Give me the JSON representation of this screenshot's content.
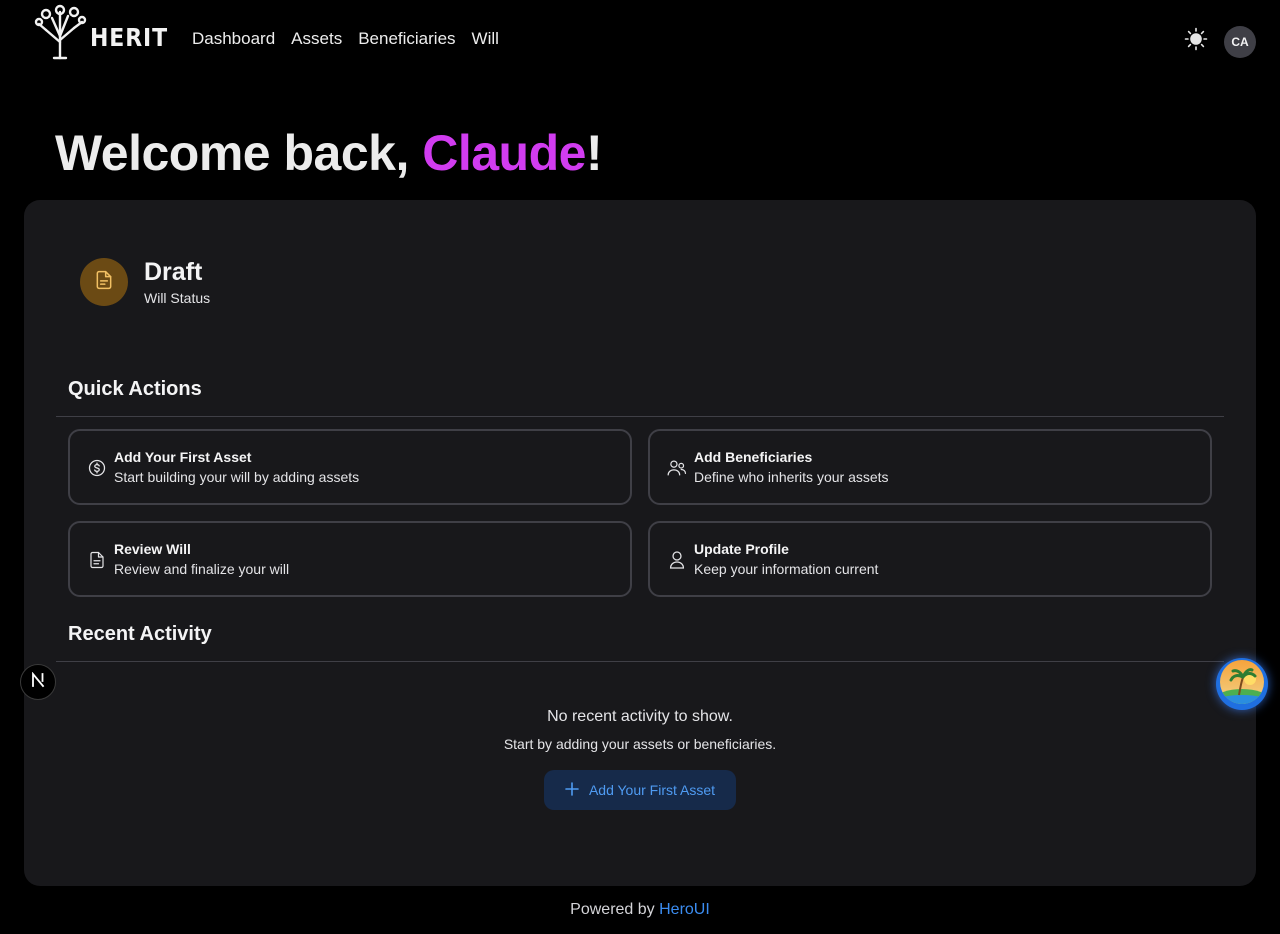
{
  "nav": {
    "brand": "HERIT",
    "links": [
      "Dashboard",
      "Assets",
      "Beneficiaries",
      "Will"
    ],
    "avatar_initials": "CA",
    "theme_icon": "sun-icon",
    "logo_icon": "tree-logo-icon"
  },
  "welcome": {
    "prefix": "Welcome back, ",
    "name": "Claude",
    "suffix": "!"
  },
  "status": {
    "title": "Draft",
    "subtitle": "Will Status",
    "icon": "document-icon"
  },
  "quick_actions": {
    "heading": "Quick Actions",
    "items": [
      {
        "title": "Add Your First Asset",
        "desc": "Start building your will by adding assets",
        "icon": "dollar-circle-icon"
      },
      {
        "title": "Add Beneficiaries",
        "desc": "Define who inherits your assets",
        "icon": "users-icon"
      },
      {
        "title": "Review Will",
        "desc": "Review and finalize your will",
        "icon": "document-icon"
      },
      {
        "title": "Update Profile",
        "desc": "Keep your information current",
        "icon": "user-icon"
      }
    ]
  },
  "recent_activity": {
    "heading": "Recent Activity",
    "empty_title": "No recent activity to show.",
    "empty_subtitle": "Start by adding your assets or beneficiaries.",
    "cta_label": "Add Your First Asset"
  },
  "footer": {
    "prefix": "Powered by",
    "link": "HeroUI"
  },
  "colors": {
    "accent_name": "#d13cf0",
    "link_blue": "#3b8cf0",
    "card_bg": "#18181b",
    "status_icon_bg": "#6b4a14"
  }
}
